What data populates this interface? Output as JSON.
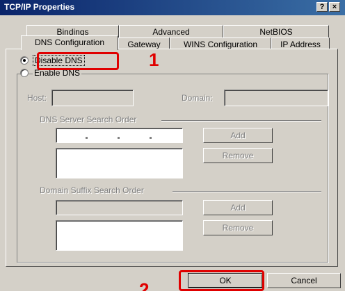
{
  "window": {
    "title": "TCP/IP Properties",
    "help_label": "?",
    "close_label": "×"
  },
  "tabs_back": [
    {
      "label": "Bindings"
    },
    {
      "label": "Advanced"
    },
    {
      "label": "NetBIOS"
    }
  ],
  "tabs_front": [
    {
      "label": "DNS Configuration"
    },
    {
      "label": "Gateway"
    },
    {
      "label": "WINS Configuration"
    },
    {
      "label": "IP Address"
    }
  ],
  "dns": {
    "disable_label": "Disable DNS",
    "enable_label": "Enable DNS",
    "selected": "disable",
    "host_label": "Host:",
    "domain_label": "Domain:",
    "server_order_label": "DNS Server Search Order",
    "suffix_order_label": "Domain Suffix Search Order",
    "add_label": "Add",
    "remove_label": "Remove"
  },
  "buttons": {
    "ok_label": "OK",
    "cancel_label": "Cancel"
  },
  "annotations": {
    "step1": "1",
    "step2": "2",
    "color": "#e00000"
  }
}
